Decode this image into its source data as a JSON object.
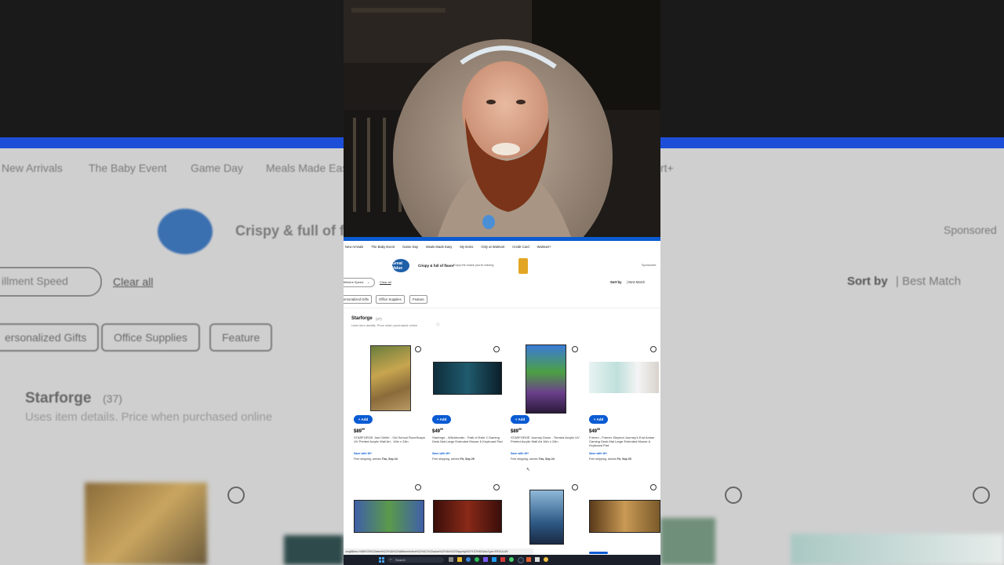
{
  "background": {
    "nav_items": [
      "New Arrivals",
      "The Baby Event",
      "Game Day",
      "Meals Made Eas",
      "rt+"
    ],
    "logo_text": "Great Value",
    "brand_tagline": "Crispy & full of flavor",
    "sponsored": "Sponsored",
    "filter_label": "illment Speed",
    "clear_all": "Clear all",
    "sort_by": "Sort by",
    "sort_value": "| Best Match",
    "chips": [
      "ersonalized Gifts",
      "Office Supplies",
      "Feature"
    ],
    "section_title": "Starforge",
    "section_count": "(37)",
    "section_note": "Uses item details. Price when purchased online"
  },
  "page": {
    "nav_items": [
      "New Arrivals",
      "The Baby Event",
      "Game Day",
      "Meals Made Easy",
      "My Items",
      "Only at Walmart",
      "Credit Card",
      "Walmart+"
    ],
    "logo_text": "Great Value",
    "brand_tagline": "Crispy & full of flavor",
    "brand_sub": "Enjoy the snack you're craving",
    "sponsored": "Sponsored",
    "filter_label": "fillment Speed",
    "clear_all": "Clear all",
    "sort_by": "Sort by",
    "sort_value": "| Best Match",
    "chips": [
      "ersonalized Gifts",
      "Office Supplies",
      "Feature"
    ],
    "section_title": "Starforge",
    "section_count": "(37)",
    "section_note": "Uses item details. Price when purchased online",
    "add_label": "+ Add",
    "products": [
      {
        "price_dollars": "$89",
        "price_cents": "99",
        "desc": "STARFORGE Just Chillin' - Old School RuneScape UV Printed Acrylic Wall Art - 16in x 24in",
        "save_with": "Save with W+",
        "shipping_prefix": "Free shipping, arrives",
        "shipping_date": "Thu, Sep 24"
      },
      {
        "price_dollars": "$49",
        "price_cents": "99",
        "desc": "Starforge - Witchhunter - Path of Exile 2 Gaming Desk Mat Large Extended Mouse & Keyboard Pad",
        "save_with": "Save with W+",
        "shipping_prefix": "Free shipping, arrives",
        "shipping_date": "Fri, Sep 25"
      },
      {
        "price_dollars": "$89",
        "price_cents": "99",
        "desc": "STARFORGE Journey Down - Terraria Acrylic UV Printed Acrylic Wall Art 16in x 24in",
        "save_with": "Save with W+",
        "shipping_prefix": "Free shipping, arrives",
        "shipping_date": "Thu, Sep 24"
      },
      {
        "price_dollars": "$49",
        "price_cents": "99",
        "desc": "Frieren - Frieren: Beyond Journey's End Anime Gaming Desk Mat Large Extended Mouse & Keyboard Pad",
        "save_with": "Save with W+",
        "shipping_prefix": "Free shipping, arrives",
        "shipping_date": "Fri, Sep 25"
      }
    ],
    "status_url": "omgBillets=%5B%7B%22intent%22%3A%22fulfillmentIntent%22%2C%22value%22%3A%22Shipping%22%7D%5D&facType=REGULAR",
    "taskbar_search": "Search"
  },
  "colors": {
    "walmart_blue": "#0a5bd3",
    "great_value_blue": "#1e5fa8"
  }
}
